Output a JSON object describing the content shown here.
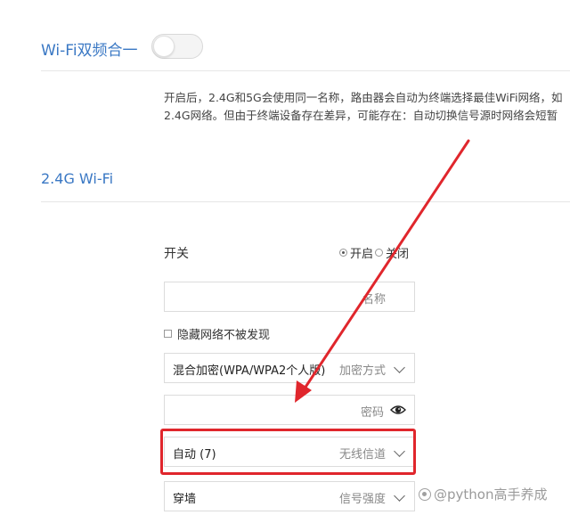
{
  "dual_band": {
    "label": "Wi-Fi双频合一",
    "enabled": false,
    "description_lines": [
      "开启后，2.4G和5G会使用同一名称，路由器会自动为终端选择最佳WiFi网络，如",
      "2.4G网络。但由于终端设备存在差异，可能存在：自动切换信号源时网络会短暂"
    ]
  },
  "wifi24": {
    "section_title": "2.4G Wi-Fi",
    "switch": {
      "label": "开关",
      "on_label": "开启",
      "off_label": "关闭",
      "selected": "on"
    },
    "name_field": {
      "value": "",
      "hint": "名称"
    },
    "hide_network": {
      "label": "隐藏网络不被发现",
      "checked": false
    },
    "encryption": {
      "value": "混合加密(WPA/WPA2个人版)",
      "hint": "加密方式"
    },
    "password": {
      "value": "",
      "hint": "密码",
      "icon": "eye-icon"
    },
    "channel": {
      "value": "自动 (7)",
      "hint": "无线信道"
    },
    "signal_strength": {
      "value": "穿墙",
      "hint": "信号强度"
    }
  },
  "annotation": {
    "color": "#e0262c"
  },
  "watermark": {
    "text": "@python高手养成"
  },
  "colors": {
    "accent": "#3a78c4",
    "border": "#dcdcdc"
  }
}
